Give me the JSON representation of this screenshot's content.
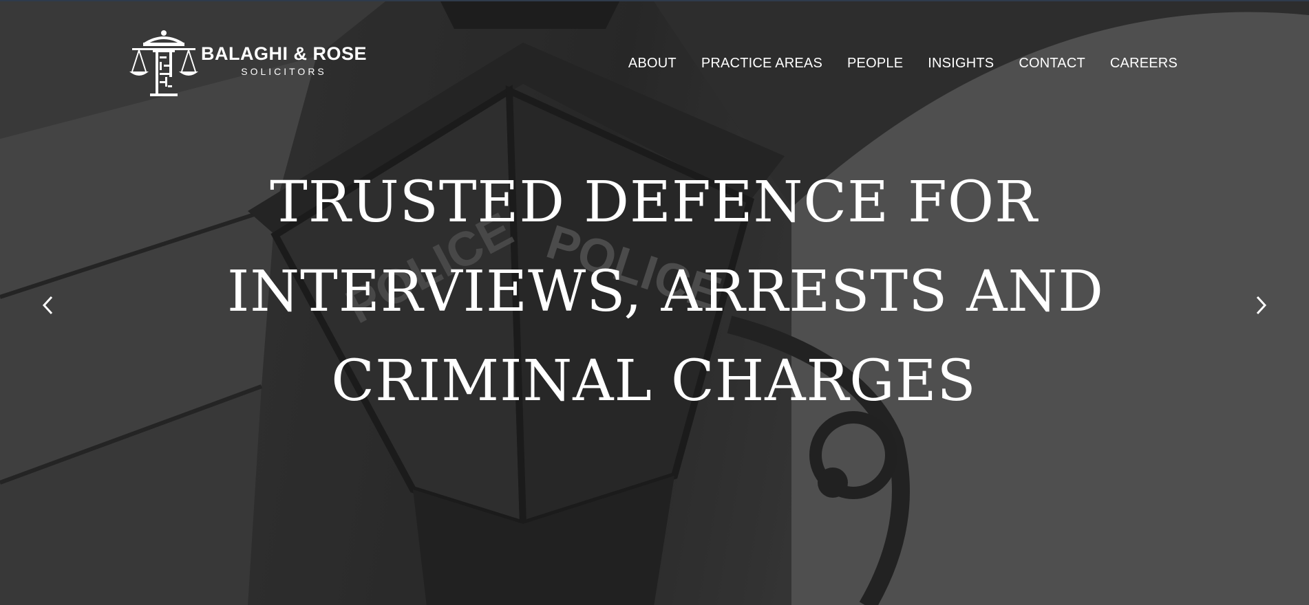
{
  "brand": {
    "name": "BALAGHI & ROSE",
    "subtitle": "SOLICITORS"
  },
  "nav": {
    "items": [
      {
        "label": "ABOUT"
      },
      {
        "label": "PRACTICE AREAS"
      },
      {
        "label": "PEOPLE"
      },
      {
        "label": "INSIGHTS"
      },
      {
        "label": "CONTACT"
      },
      {
        "label": "CAREERS"
      }
    ]
  },
  "hero": {
    "headline_lines": [
      "TRUSTED DEFENCE FOR",
      "INTERVIEWS, ARRESTS AND",
      "CRIMINAL CHARGES"
    ],
    "lamp_sign_text": "POLICE"
  },
  "icons": {
    "logo": "scales-of-justice-icon",
    "prev": "chevron-left-icon",
    "next": "chevron-right-icon"
  },
  "colors": {
    "text": "#ffffff",
    "top_border": "#2f3b4c"
  }
}
